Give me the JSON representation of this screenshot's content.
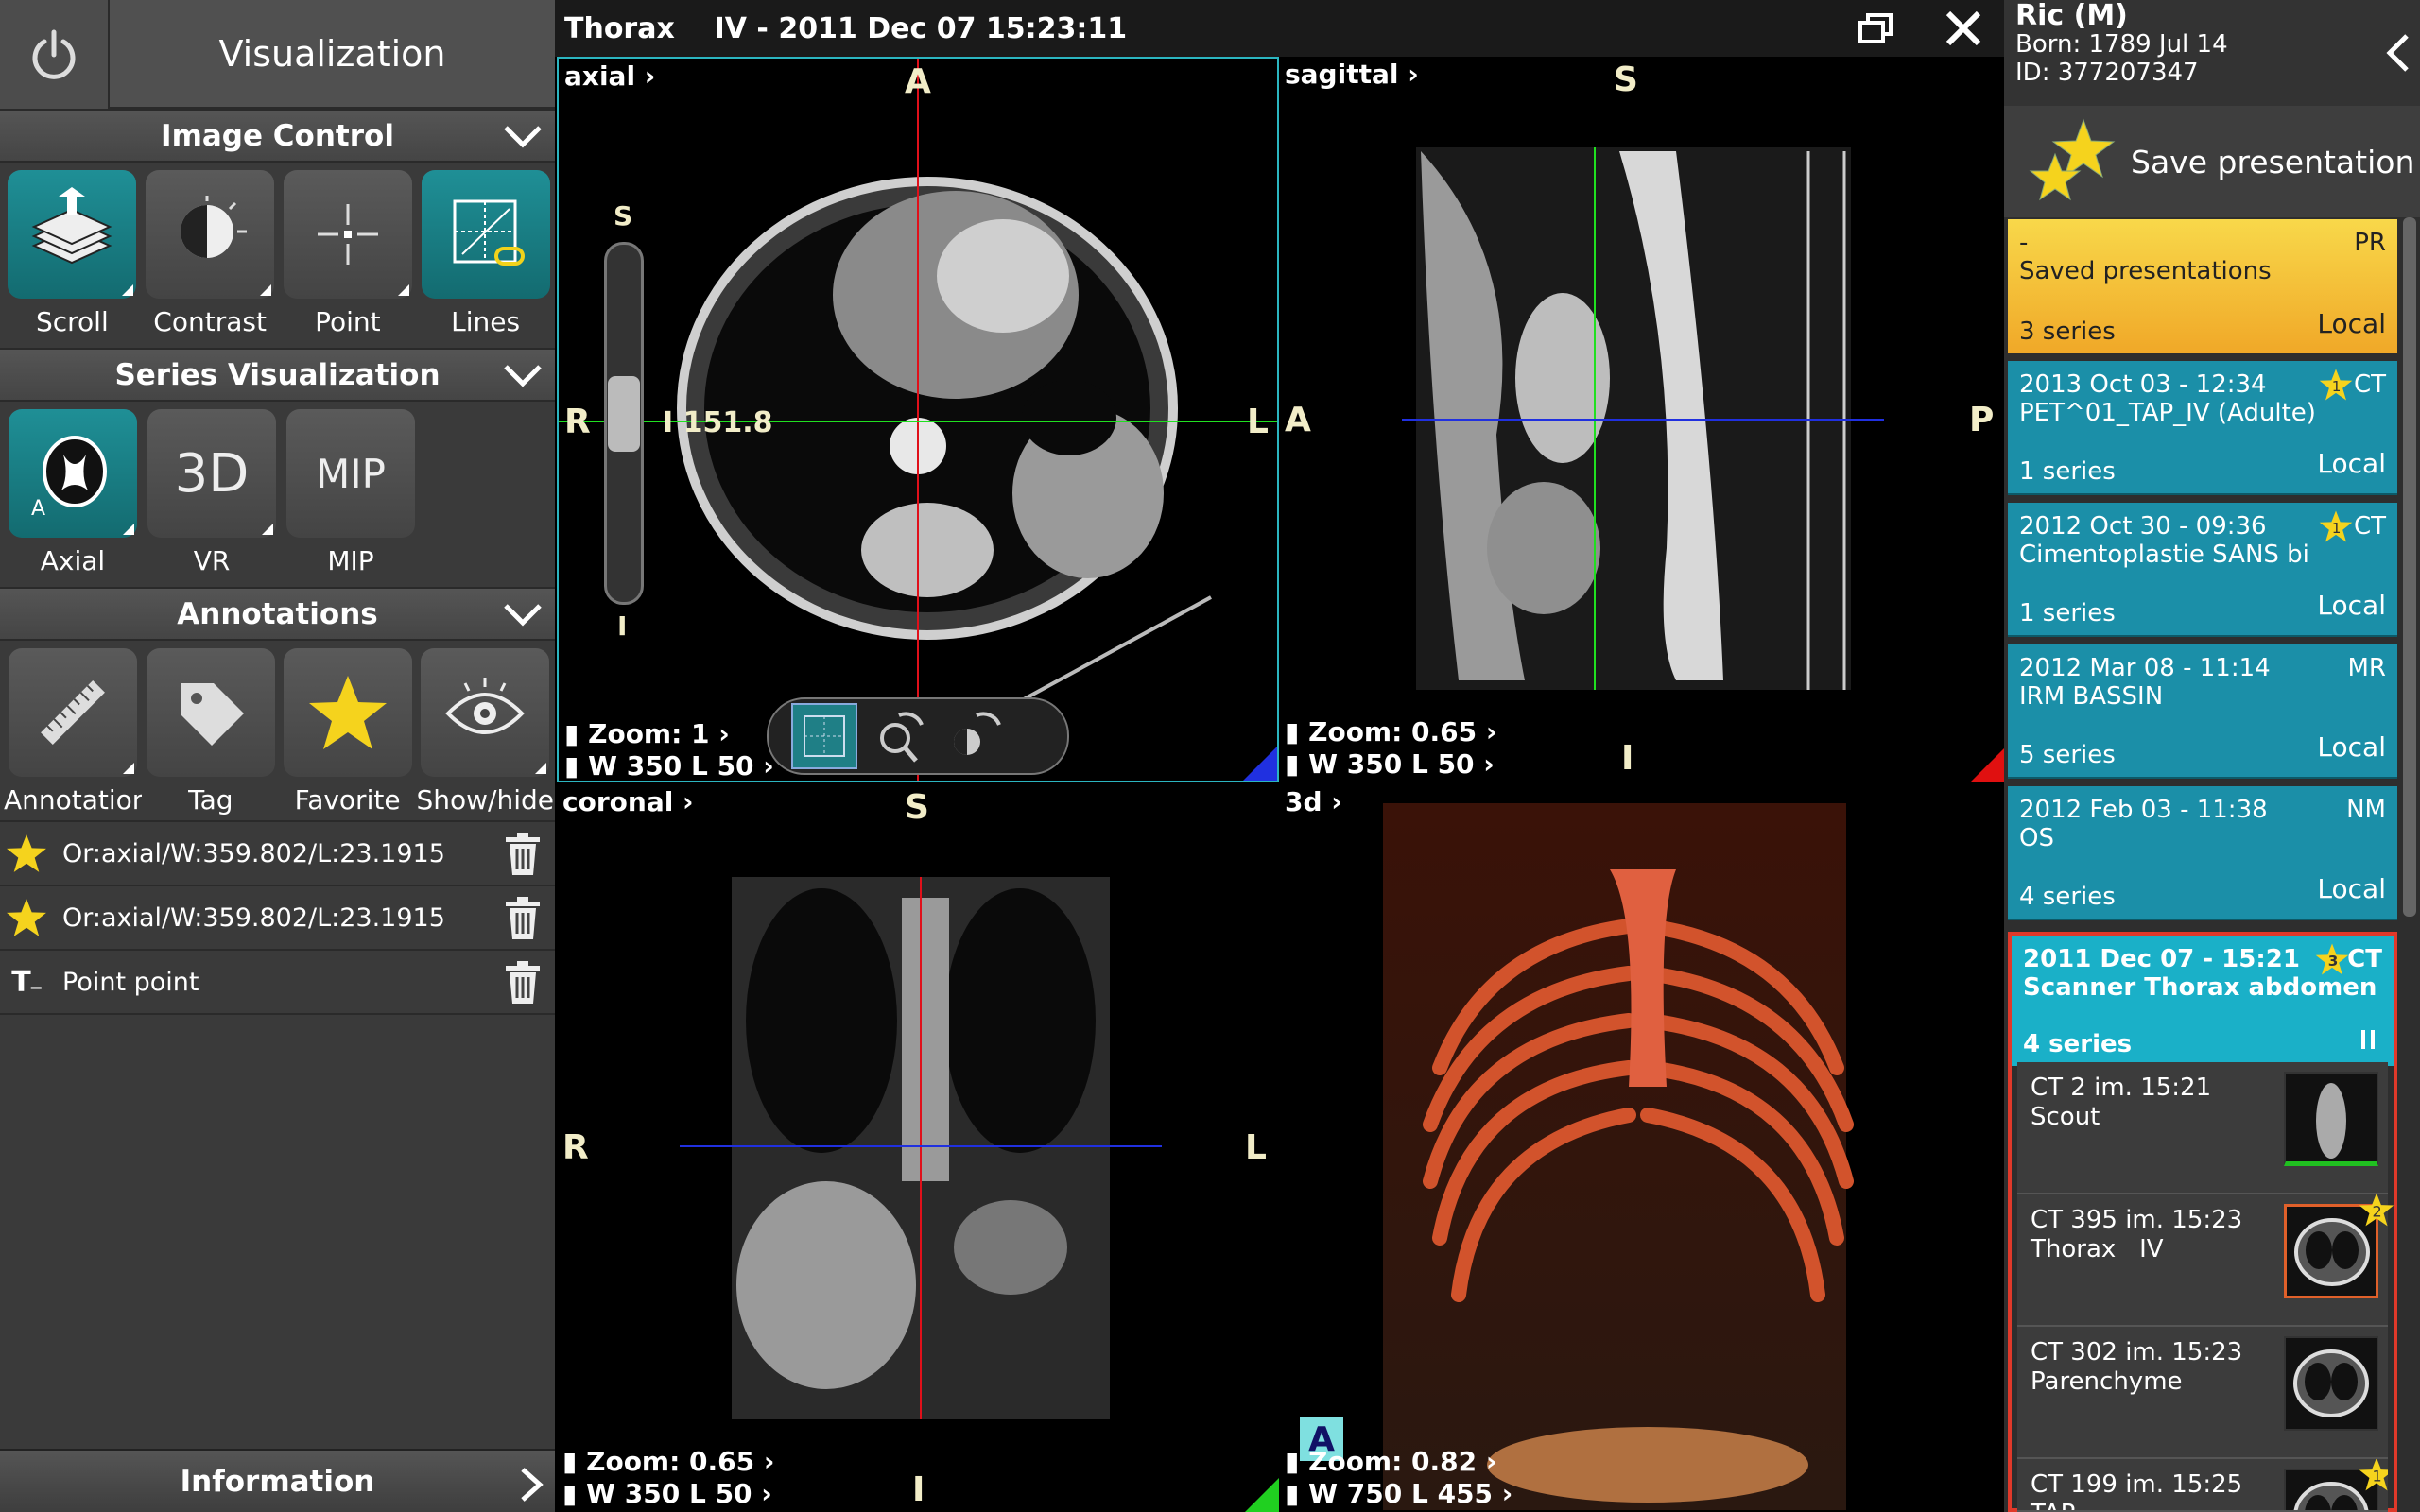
{
  "header": {
    "title": "Visualization"
  },
  "image_control": {
    "title": "Image Control",
    "tools": [
      {
        "label": "Scroll",
        "active": true
      },
      {
        "label": "Contrast",
        "active": false
      },
      {
        "label": "Point",
        "active": false
      },
      {
        "label": "Lines",
        "active": true
      }
    ]
  },
  "series_visualization": {
    "title": "Series Visualization",
    "tools": [
      {
        "label": "Axial",
        "active": true,
        "sub": "A"
      },
      {
        "label": "VR",
        "active": false,
        "icon_text": "3D"
      },
      {
        "label": "MIP",
        "active": false,
        "icon_text": "MIP"
      }
    ]
  },
  "annotations": {
    "title": "Annotations",
    "tools": [
      {
        "label": "Annotations"
      },
      {
        "label": "Tag"
      },
      {
        "label": "Favorite"
      },
      {
        "label": "Show/hide"
      }
    ],
    "items": [
      {
        "icon": "star-icon",
        "text": "Or:axial/W:359.802/L:23.1915"
      },
      {
        "icon": "star-icon",
        "text": "Or:axial/W:359.802/L:23.1915"
      },
      {
        "icon": "text-icon",
        "text": "Point point",
        "icon_text": "T"
      }
    ]
  },
  "information": {
    "label": "Information"
  },
  "viewer": {
    "title": "Thorax    IV - 2011 Dec 07 15:23:11",
    "viewports": {
      "axial": {
        "name": "axial",
        "top": "A",
        "left": "R",
        "right": "L",
        "slider_top": "S",
        "slider_bottom": "I",
        "position": "I 151.8",
        "zoom": "Zoom: 1",
        "wl": "W 350 L 50"
      },
      "sagittal": {
        "name": "sagittal",
        "top": "S",
        "left": "A",
        "right": "P",
        "bottom": "I",
        "zoom": "Zoom: 0.65",
        "wl": "W 350 L 50"
      },
      "coronal": {
        "name": "coronal",
        "top": "S",
        "left": "R",
        "right": "L",
        "bottom": "I",
        "zoom": "Zoom: 0.65",
        "wl": "W 350 L 50"
      },
      "threed": {
        "name": "3d",
        "orient_marker": "A",
        "zoom": "Zoom: 0.82",
        "wl": "W 750 L 455"
      }
    }
  },
  "patient": {
    "name": "Ric (M)",
    "born": "Born: 1789 Jul 14",
    "id": "ID: 377207347"
  },
  "save_presentation": {
    "label": "Save presentation"
  },
  "studies": [
    {
      "date": "-",
      "type": "PR",
      "desc": "Saved presentations",
      "series": "3 series",
      "location": "Local",
      "color": "#f2c030"
    },
    {
      "date": "2013 Oct 03 - 12:34",
      "type": "CT",
      "desc": "PET^01_TAP_IV (Adulte)",
      "series": "1 series",
      "location": "Local",
      "badge": "1",
      "color": "#1b8fa8"
    },
    {
      "date": "2012 Oct 30 - 09:36",
      "type": "CT",
      "desc": "Cimentoplastie SANS bi",
      "series": "1 series",
      "location": "Local",
      "badge": "1",
      "color": "#1b8fa8"
    },
    {
      "date": "2012 Mar 08 - 11:14",
      "type": "MR",
      "desc": "IRM BASSIN",
      "series": "5 series",
      "location": "Local",
      "color": "#1b8fa8"
    },
    {
      "date": "2012 Feb 03 - 11:38",
      "type": "NM",
      "desc": "OS",
      "series": "4 series",
      "location": "Local",
      "color": "#1b8fa8"
    },
    {
      "date": "2011 Dec 07 - 15:21",
      "type": "CT",
      "desc": "Scanner Thorax abdomen",
      "series": "4 series",
      "badge": "3",
      "color": "#1ab0c8",
      "selected": true
    }
  ],
  "series_items": [
    {
      "line1": "CT 2 im. 15:21",
      "line2": "Scout"
    },
    {
      "line1": "CT 395 im. 15:23",
      "line2": "Thorax   IV",
      "badge": "2",
      "selected": true
    },
    {
      "line1": "CT 302 im. 15:23",
      "line2": "Parenchyme"
    },
    {
      "line1": "CT 199 im. 15:25",
      "line2": "TAP",
      "badge": "1"
    }
  ]
}
